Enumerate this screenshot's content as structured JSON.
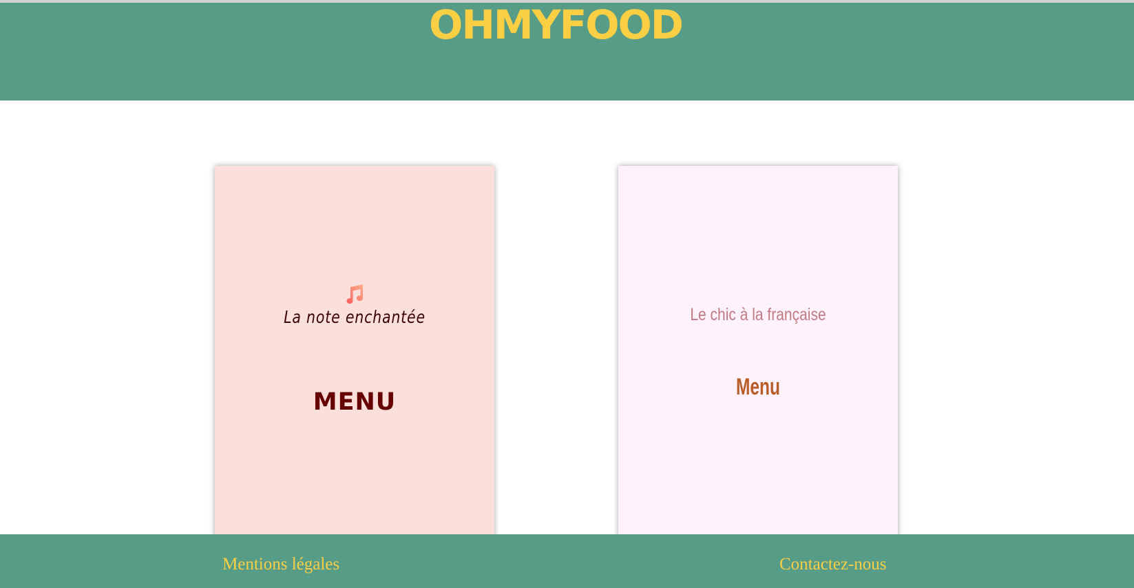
{
  "header": {
    "logo": "OHMYFOOD"
  },
  "restaurants": [
    {
      "name": "La note enchantée",
      "icon": "music-note-icon",
      "menu_label": "MENU",
      "background": "#fadfdb",
      "title_color": "#3b0000",
      "menu_color": "#660000"
    },
    {
      "name": "Le chic à la française",
      "menu_label": "Menu",
      "background": "#fff2fc",
      "title_color": "#c27a83",
      "menu_color": "#b85c28"
    }
  ],
  "footer": {
    "legal_label": "Mentions légales",
    "contact_label": "Contactez-nous"
  },
  "colors": {
    "brand_green": "#579c87",
    "brand_yellow": "#fbcf44",
    "note_icon_gradient": [
      "#ff6b6b",
      "#ffa38a"
    ]
  }
}
